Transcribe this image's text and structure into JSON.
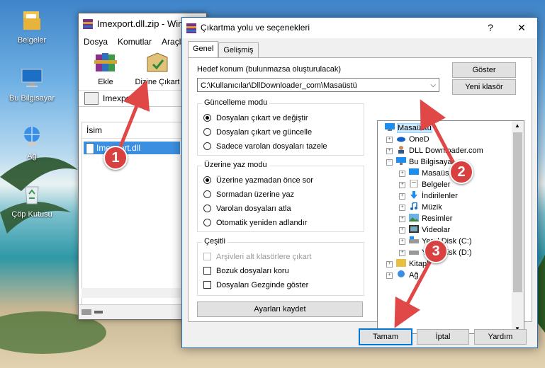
{
  "desktop": {
    "icons": [
      {
        "label": "Belgeler",
        "icon": "folder-documents-icon"
      },
      {
        "label": "Bu Bilgisayar",
        "icon": "computer-icon"
      },
      {
        "label": "Ağ",
        "icon": "network-icon"
      },
      {
        "label": "Çöp Kutusu",
        "icon": "recycle-bin-icon"
      }
    ]
  },
  "back_window": {
    "title": "Imexport.dll.zip - Win",
    "menu": [
      "Dosya",
      "Komutlar",
      "Araçla"
    ],
    "tools": [
      {
        "label": "Ekle",
        "icon": "books-add-icon"
      },
      {
        "label": "Dizine Çıkart",
        "icon": "extract-folder-icon"
      }
    ],
    "path": "Imexport.dll",
    "list_header": "İsim",
    "file": "Imexport.dll"
  },
  "dialog": {
    "title": "Çıkartma yolu ve seçenekleri",
    "help": "?",
    "close": "✕",
    "tabs": [
      "Genel",
      "Gelişmiş"
    ],
    "dest_label": "Hedef konum (bulunmazsa oluşturulacak)",
    "dest_value": "C:\\Kullanıcılar\\DllDownloader_com\\Masaüstü",
    "btn_show": "Göster",
    "btn_new_folder": "Yeni klasör",
    "update_mode": {
      "title": "Güncelleme modu",
      "options": [
        "Dosyaları çıkart ve değiştir",
        "Dosyaları çıkart ve güncelle",
        "Sadece varolan dosyaları tazele"
      ],
      "selected": 0
    },
    "overwrite_mode": {
      "title": "Üzerine yaz modu",
      "options": [
        "Üzerine yazmadan önce sor",
        "Sormadan üzerine yaz",
        "Varolan dosyaları atla",
        "Otomatik yeniden adlandır"
      ],
      "selected": 0
    },
    "misc": {
      "title": "Çeşitli",
      "options": [
        "Arşivleri alt klasörlere çıkart",
        "Bozuk dosyaları koru",
        "Dosyaları Gezginde göster"
      ],
      "disabled": [
        true,
        false,
        false
      ]
    },
    "btn_save": "Ayarları kaydet",
    "tree": [
      {
        "label": "Masaüstü",
        "icon": "desktop-icon",
        "level": 0,
        "selected": true
      },
      {
        "label": "OneD",
        "icon": "cloud-icon",
        "level": 1
      },
      {
        "label": "DLL Downloader.com",
        "icon": "user-icon",
        "level": 1
      },
      {
        "label": "Bu Bilgisayar",
        "icon": "computer-icon",
        "level": 1
      },
      {
        "label": "Masaüstü",
        "icon": "desktop-icon",
        "level": 2
      },
      {
        "label": "Belgeler",
        "icon": "documents-icon",
        "level": 2
      },
      {
        "label": "İndirilenler",
        "icon": "download-icon",
        "level": 2
      },
      {
        "label": "Müzik",
        "icon": "music-icon",
        "level": 2
      },
      {
        "label": "Resimler",
        "icon": "pictures-icon",
        "level": 2
      },
      {
        "label": "Videolar",
        "icon": "video-icon",
        "level": 2
      },
      {
        "label": "Yerel Disk (C:)",
        "icon": "disk-icon",
        "level": 2
      },
      {
        "label": "Yerel Disk (D:)",
        "icon": "disk-icon",
        "level": 2
      },
      {
        "label": "Kitapl",
        "icon": "library-icon",
        "level": 1
      },
      {
        "label": "Ağ",
        "icon": "network-icon",
        "level": 1
      }
    ],
    "footer": [
      "Tamam",
      "İptal",
      "Yardım"
    ]
  },
  "annotations": [
    "1",
    "2",
    "3"
  ],
  "colors": {
    "accent": "#0078d7",
    "badge": "#d94040",
    "arrow": "#e04848"
  }
}
